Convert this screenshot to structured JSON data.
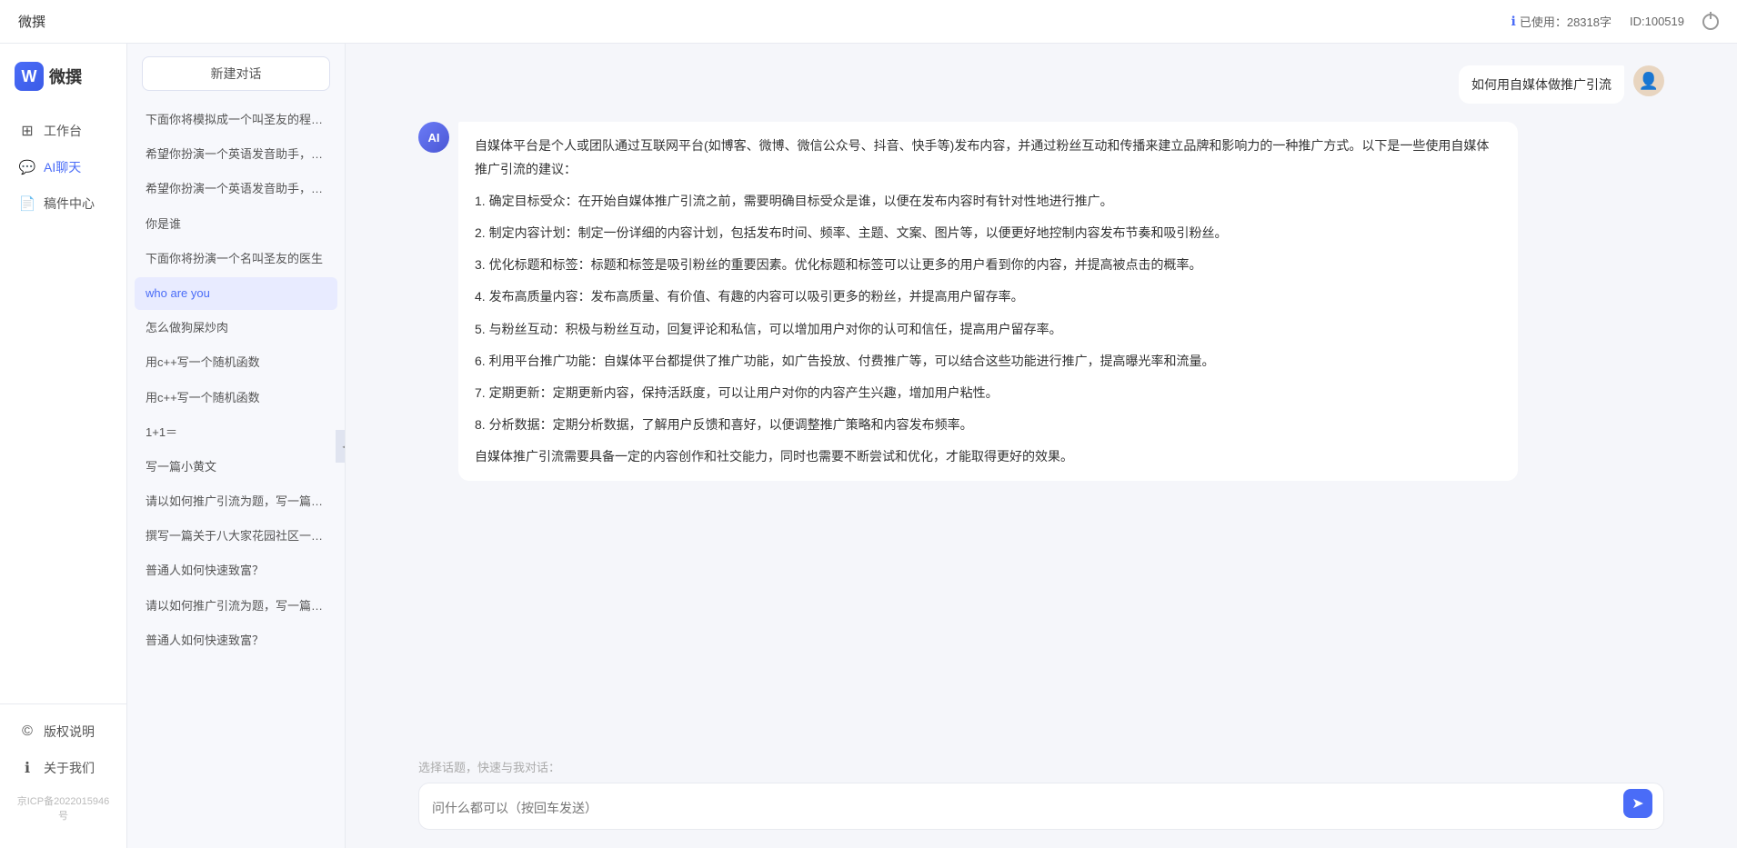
{
  "topbar": {
    "title": "微撰",
    "usage_label": "已使用：28318字",
    "id_label": "ID:100519"
  },
  "left_nav": {
    "logo_letter": "W",
    "logo_text": "微撰",
    "items": [
      {
        "id": "workbench",
        "label": "工作台",
        "icon": "⊞"
      },
      {
        "id": "ai-chat",
        "label": "AI聊天",
        "icon": "💬"
      },
      {
        "id": "drafts",
        "label": "稿件中心",
        "icon": "📄"
      }
    ],
    "bottom_items": [
      {
        "id": "copyright",
        "label": "版权说明",
        "icon": "©"
      },
      {
        "id": "about",
        "label": "关于我们",
        "icon": "ℹ"
      }
    ],
    "icp": "京ICP备2022015946号"
  },
  "sidebar": {
    "new_btn": "新建对话",
    "items": [
      {
        "id": 1,
        "text": "下面你将模拟成一个叫圣友的程序员，我说..."
      },
      {
        "id": 2,
        "text": "希望你扮演一个英语发音助手，我提供给你..."
      },
      {
        "id": 3,
        "text": "希望你扮演一个英语发音助手，我提供给你..."
      },
      {
        "id": 4,
        "text": "你是谁"
      },
      {
        "id": 5,
        "text": "下面你将扮演一个名叫圣友的医生"
      },
      {
        "id": 6,
        "text": "who are you",
        "active": true
      },
      {
        "id": 7,
        "text": "怎么做狗屎炒肉"
      },
      {
        "id": 8,
        "text": "用c++写一个随机函数"
      },
      {
        "id": 9,
        "text": "用c++写一个随机函数"
      },
      {
        "id": 10,
        "text": "1+1＝"
      },
      {
        "id": 11,
        "text": "写一篇小黄文"
      },
      {
        "id": 12,
        "text": "请以如何推广引流为题，写一篇大纲"
      },
      {
        "id": 13,
        "text": "撰写一篇关于八大家花园社区一刻钟便民生..."
      },
      {
        "id": 14,
        "text": "普通人如何快速致富？"
      },
      {
        "id": 15,
        "text": "请以如何推广引流为题，写一篇大纲"
      },
      {
        "id": 16,
        "text": "普通人如何快速致富？"
      }
    ]
  },
  "chat": {
    "user_message": "如何用自媒体做推广引流",
    "ai_response": {
      "paragraphs": [
        "自媒体平台是个人或团队通过互联网平台(如博客、微博、微信公众号、抖音、快手等)发布内容，并通过粉丝互动和传播来建立品牌和影响力的一种推广方式。以下是一些使用自媒体推广引流的建议：",
        "1. 确定目标受众：在开始自媒体推广引流之前，需要明确目标受众是谁，以便在发布内容时有针对性地进行推广。",
        "2. 制定内容计划：制定一份详细的内容计划，包括发布时间、频率、主题、文案、图片等，以便更好地控制内容发布节奏和吸引粉丝。",
        "3. 优化标题和标签：标题和标签是吸引粉丝的重要因素。优化标题和标签可以让更多的用户看到你的内容，并提高被点击的概率。",
        "4. 发布高质量内容：发布高质量、有价值、有趣的内容可以吸引更多的粉丝，并提高用户留存率。",
        "5. 与粉丝互动：积极与粉丝互动，回复评论和私信，可以增加用户对你的认可和信任，提高用户留存率。",
        "6. 利用平台推广功能：自媒体平台都提供了推广功能，如广告投放、付费推广等，可以结合这些功能进行推广，提高曝光率和流量。",
        "7. 定期更新：定期更新内容，保持活跃度，可以让用户对你的内容产生兴趣，增加用户粘性。",
        "8. 分析数据：定期分析数据，了解用户反馈和喜好，以便调整推广策略和内容发布频率。",
        "自媒体推广引流需要具备一定的内容创作和社交能力，同时也需要不断尝试和优化，才能取得更好的效果。"
      ]
    },
    "input_placeholder": "问什么都可以（按回车发送）",
    "quick_select_label": "选择话题，快速与我对话："
  }
}
